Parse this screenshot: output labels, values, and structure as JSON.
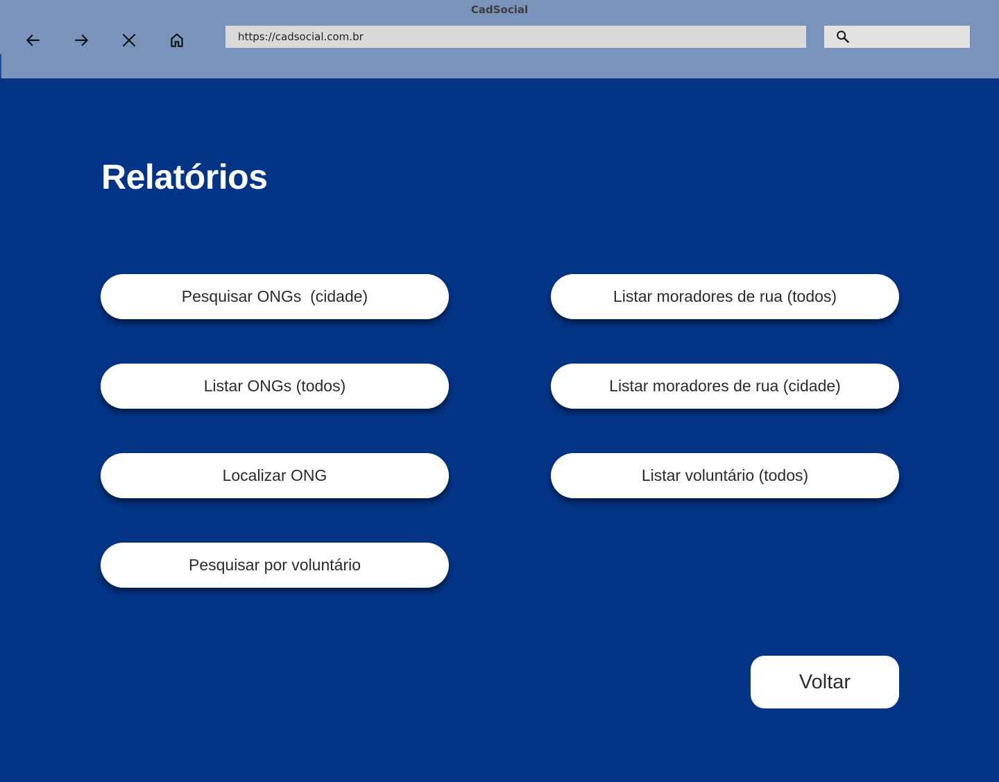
{
  "window": {
    "title": "CadSocial"
  },
  "browser": {
    "url": "https://cadsocial.com.br",
    "search_placeholder": ""
  },
  "page": {
    "title": "Relatórios"
  },
  "reports": {
    "left": [
      "Pesquisar ONGs  (cidade)",
      "Listar ONGs (todos)",
      "Localizar ONG",
      "Pesquisar por voluntário"
    ],
    "right": [
      "Listar moradores de rua (todos)",
      "Listar moradores de rua (cidade)",
      "Listar voluntário (todos)"
    ]
  },
  "actions": {
    "back_label": "Voltar"
  },
  "colors": {
    "background": "#033485",
    "chrome": "#7a93bb",
    "button": "#ffffff"
  }
}
